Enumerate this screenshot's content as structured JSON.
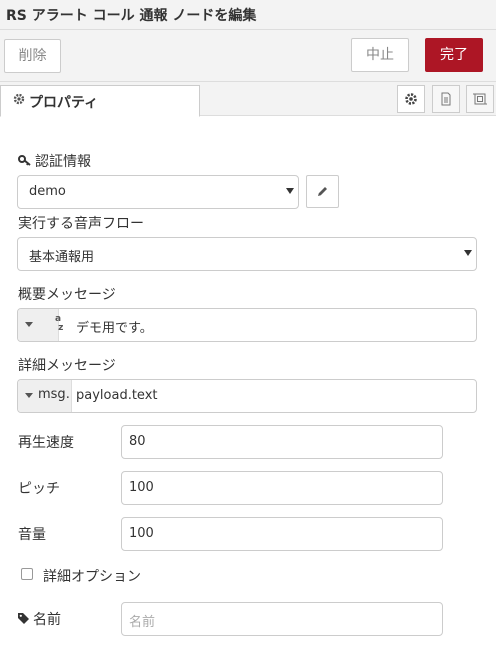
{
  "window": {
    "title": "RS アラート コール 通報 ノードを編集"
  },
  "toolbar": {
    "delete_label": "削除",
    "cancel_label": "中止",
    "done_label": "完了"
  },
  "tabs": {
    "properties_label": "プロパティ"
  },
  "form": {
    "credentials": {
      "label": "認証情報",
      "value": "demo"
    },
    "voice_flow": {
      "label": "実行する音声フロー",
      "value": "基本通報用"
    },
    "summary": {
      "label": "概要メッセージ",
      "type_icon": "az",
      "value": "デモ用です。"
    },
    "detail": {
      "label": "詳細メッセージ",
      "type_prefix": "msg.",
      "value": "payload.text"
    },
    "speed": {
      "label": "再生速度",
      "value": "80"
    },
    "pitch": {
      "label": "ピッチ",
      "value": "100"
    },
    "volume": {
      "label": "音量",
      "value": "100"
    },
    "detail_options": {
      "label": "詳細オプション",
      "checked": false
    },
    "name": {
      "label": "名前",
      "placeholder": "名前"
    }
  },
  "colors": {
    "done_button": "#ad1625",
    "header_bg": "#f3f3f3"
  }
}
